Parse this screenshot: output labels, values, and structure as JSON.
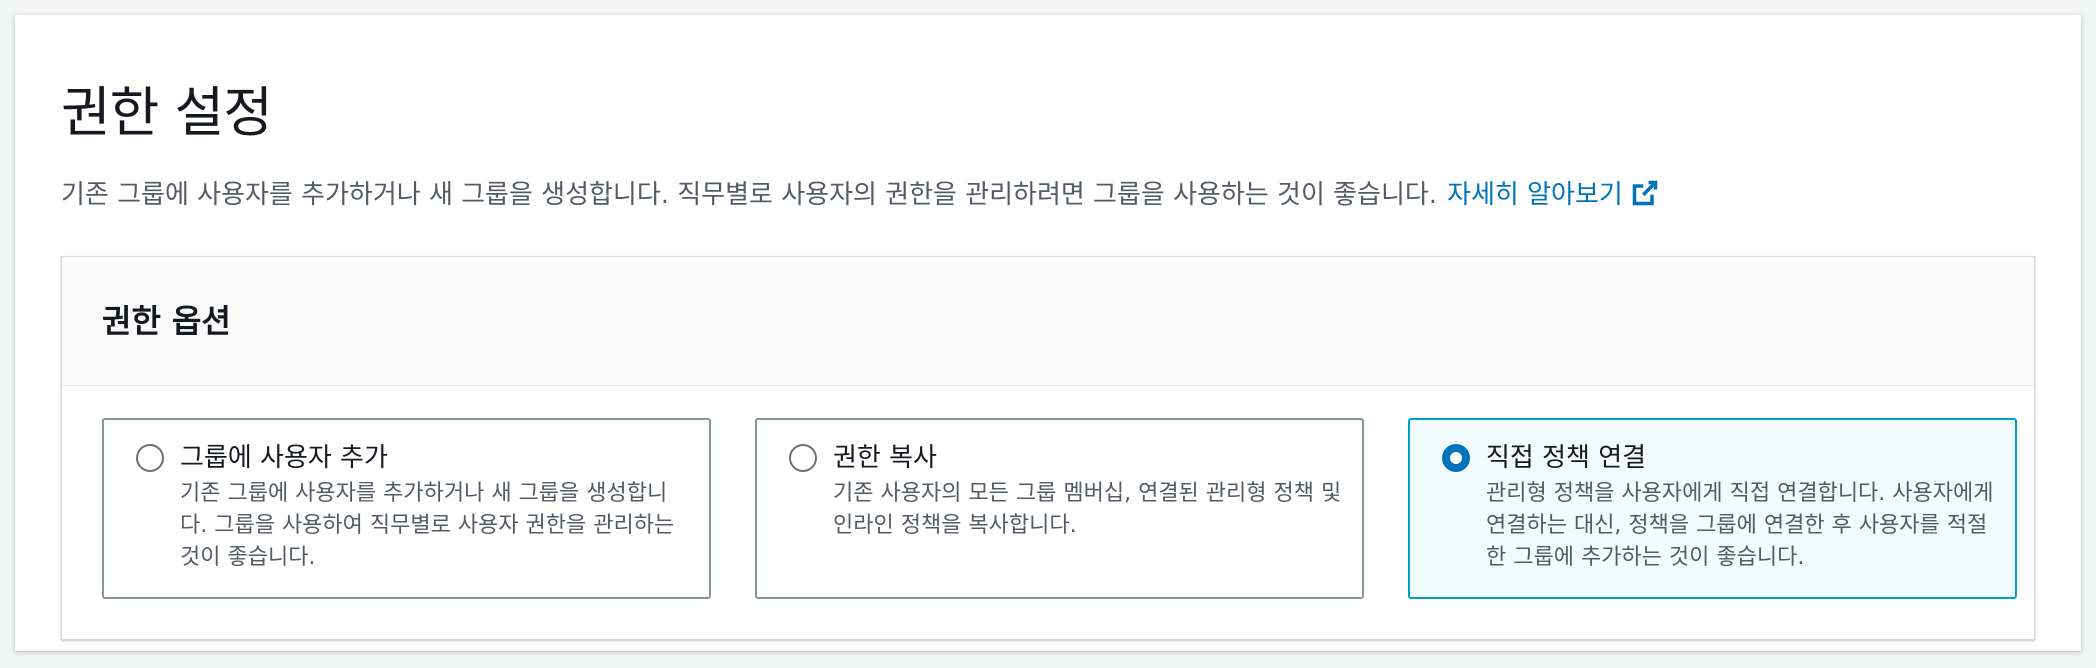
{
  "header": {
    "title": "권한 설정",
    "description": "기존 그룹에 사용자를 추가하거나 새 그룹을 생성합니다. 직무별로 사용자의 권한을 관리하려면 그룹을 사용하는 것이 좋습니다.",
    "learn_more": "자세히 알아보기",
    "learn_more_icon": "external-link-icon"
  },
  "options": {
    "title": "권한 옵션",
    "selected": "attach-policies",
    "tiles": [
      {
        "id": "add-to-group",
        "label": "그룹에 사용자 추가",
        "description": "기존 그룹에 사용자를 추가하거나 새 그룹을 생성합니다. 그룹을 사용하여 직무별로 사용자 권한을 관리하는 것이 좋습니다."
      },
      {
        "id": "copy-permissions",
        "label": "권한 복사",
        "description": "기존 사용자의 모든 그룹 멤버십, 연결된 관리형 정책 및 인라인 정책을 복사합니다."
      },
      {
        "id": "attach-policies",
        "label": "직접 정책 연결",
        "description": "관리형 정책을 사용자에게 직접 연결합니다. 사용자에게 연결하는 대신, 정책을 그룹에 연결한 후 사용자를 적절한 그룹에 추가하는 것이 좋습니다."
      }
    ]
  },
  "colors": {
    "link": "#0073bb",
    "selected_border": "#00a1c9",
    "selected_background": "#f1faff",
    "text": "#16191f",
    "secondary_text": "#545b64"
  }
}
